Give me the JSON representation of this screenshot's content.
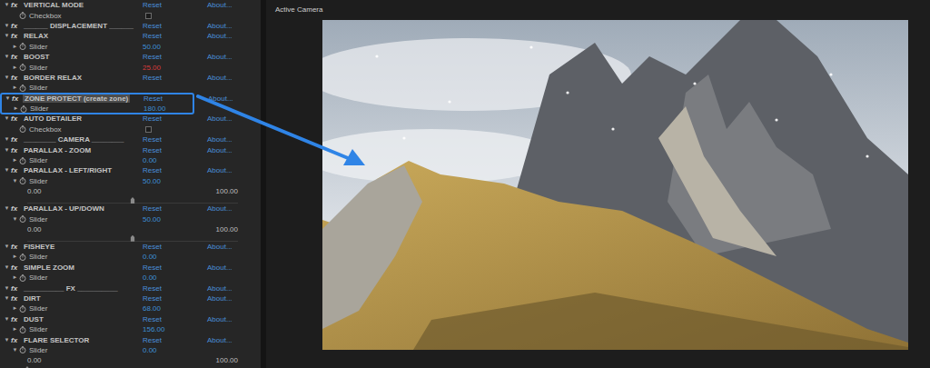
{
  "viewer": {
    "title": "Active Camera"
  },
  "effect_rows": [
    {
      "kind": "effect",
      "twisty": "▼",
      "badge": "fx",
      "name": "VERTICAL MODE",
      "reset": "Reset",
      "about": "About...",
      "selected": false,
      "callout": false
    },
    {
      "kind": "checkbox",
      "name": "Checkbox",
      "checked": false,
      "callout": false
    },
    {
      "kind": "effect",
      "twisty": "▼",
      "badge": "fx",
      "name": "______ DISPLACEMENT ______",
      "reset": "Reset",
      "about": "About...",
      "selected": false,
      "callout": false
    },
    {
      "kind": "effect",
      "twisty": "▼",
      "badge": "fx",
      "name": "RELAX",
      "reset": "Reset",
      "about": "About...",
      "selected": false,
      "callout": false
    },
    {
      "kind": "param",
      "twisty": "►",
      "name": "Slider",
      "value": "50.00",
      "color": "#3d8fd6",
      "callout": false
    },
    {
      "kind": "effect",
      "twisty": "▼",
      "badge": "fx",
      "name": "BOOST",
      "reset": "Reset",
      "about": "About...",
      "selected": false,
      "callout": false
    },
    {
      "kind": "param",
      "twisty": "►",
      "name": "Slider",
      "value": "25.00",
      "color": "#d83b3b",
      "callout": false
    },
    {
      "kind": "effect",
      "twisty": "▼",
      "badge": "fx",
      "name": "BORDER RELAX",
      "reset": "Reset",
      "about": "About...",
      "selected": false,
      "callout": false
    },
    {
      "kind": "param",
      "twisty": "►",
      "name": "Slider",
      "color": "#3d8fd6",
      "callout": false
    },
    {
      "kind": "effect",
      "twisty": "▼",
      "badge": "fx",
      "name": "ZONE PROTECT (create zone)",
      "reset": "Reset",
      "about": "About...",
      "selected": true,
      "callout": true
    },
    {
      "kind": "param",
      "twisty": "►",
      "name": "Slider",
      "value": "180.00",
      "color": "#3d8fd6",
      "callout": true
    },
    {
      "kind": "effect",
      "twisty": "▼",
      "badge": "fx",
      "name": "AUTO DETAILER",
      "reset": "Reset",
      "about": "About...",
      "selected": false,
      "callout": false
    },
    {
      "kind": "checkbox",
      "name": "Checkbox",
      "checked": false,
      "callout": false
    },
    {
      "kind": "effect",
      "twisty": "▼",
      "badge": "fx",
      "name": "________ CAMERA ________",
      "reset": "Reset",
      "about": "About...",
      "selected": false,
      "callout": false
    },
    {
      "kind": "effect",
      "twisty": "▼",
      "badge": "fx",
      "name": "PARALLAX - ZOOM",
      "reset": "Reset",
      "about": "About...",
      "selected": false,
      "callout": false
    },
    {
      "kind": "param",
      "twisty": "►",
      "name": "Slider",
      "value": "0.00",
      "color": "#3d8fd6",
      "callout": false
    },
    {
      "kind": "effect",
      "twisty": "▼",
      "badge": "fx",
      "name": "PARALLAX - LEFT/RIGHT",
      "reset": "Reset",
      "about": "About...",
      "selected": false,
      "callout": false
    },
    {
      "kind": "param",
      "twisty": "▼",
      "name": "Slider",
      "value": "50.00",
      "color": "#3d8fd6",
      "callout": false
    },
    {
      "kind": "range",
      "min": "0.00",
      "max": "100.00",
      "level": 0.5,
      "callout": false
    },
    {
      "kind": "effect",
      "twisty": "▼",
      "badge": "fx",
      "name": "PARALLAX - UP/DOWN",
      "reset": "Reset",
      "about": "About...",
      "selected": false,
      "callout": false
    },
    {
      "kind": "param",
      "twisty": "▼",
      "name": "Slider",
      "value": "50.00",
      "color": "#3d8fd6",
      "callout": false
    },
    {
      "kind": "range",
      "min": "0.00",
      "max": "100.00",
      "level": 0.5,
      "callout": false
    },
    {
      "kind": "effect",
      "twisty": "▼",
      "badge": "fx",
      "name": "FISHEYE",
      "reset": "Reset",
      "about": "About...",
      "selected": false,
      "callout": false
    },
    {
      "kind": "param",
      "twisty": "►",
      "name": "Slider",
      "value": "0.00",
      "color": "#3d8fd6",
      "callout": false
    },
    {
      "kind": "effect",
      "twisty": "▼",
      "badge": "fx",
      "name": "SIMPLE ZOOM",
      "reset": "Reset",
      "about": "About...",
      "selected": false,
      "callout": false
    },
    {
      "kind": "param",
      "twisty": "►",
      "name": "Slider",
      "value": "0.00",
      "color": "#3d8fd6",
      "callout": false
    },
    {
      "kind": "effect",
      "twisty": "▼",
      "badge": "fx",
      "name": "__________ FX __________",
      "reset": "Reset",
      "about": "About...",
      "selected": false,
      "callout": false
    },
    {
      "kind": "effect",
      "twisty": "▼",
      "badge": "fx",
      "name": "DIRT",
      "reset": "Reset",
      "about": "About...",
      "selected": false,
      "callout": false
    },
    {
      "kind": "param",
      "twisty": "►",
      "name": "Slider",
      "value": "68.00",
      "color": "#3d8fd6",
      "callout": false
    },
    {
      "kind": "effect",
      "twisty": "▼",
      "badge": "fx",
      "name": "DUST",
      "reset": "Reset",
      "about": "About...",
      "selected": false,
      "callout": false
    },
    {
      "kind": "param",
      "twisty": "►",
      "name": "Slider",
      "value": "156.00",
      "color": "#3d8fd6",
      "callout": false
    },
    {
      "kind": "effect",
      "twisty": "▼",
      "badge": "fx",
      "name": "FLARE SELECTOR",
      "reset": "Reset",
      "about": "About...",
      "selected": false,
      "callout": false
    },
    {
      "kind": "param",
      "twisty": "▼",
      "name": "Slider",
      "value": "0.00",
      "color": "#3d8fd6",
      "callout": false
    },
    {
      "kind": "range",
      "min": "0.00",
      "max": "100.00",
      "level": 0,
      "callout": false
    }
  ]
}
